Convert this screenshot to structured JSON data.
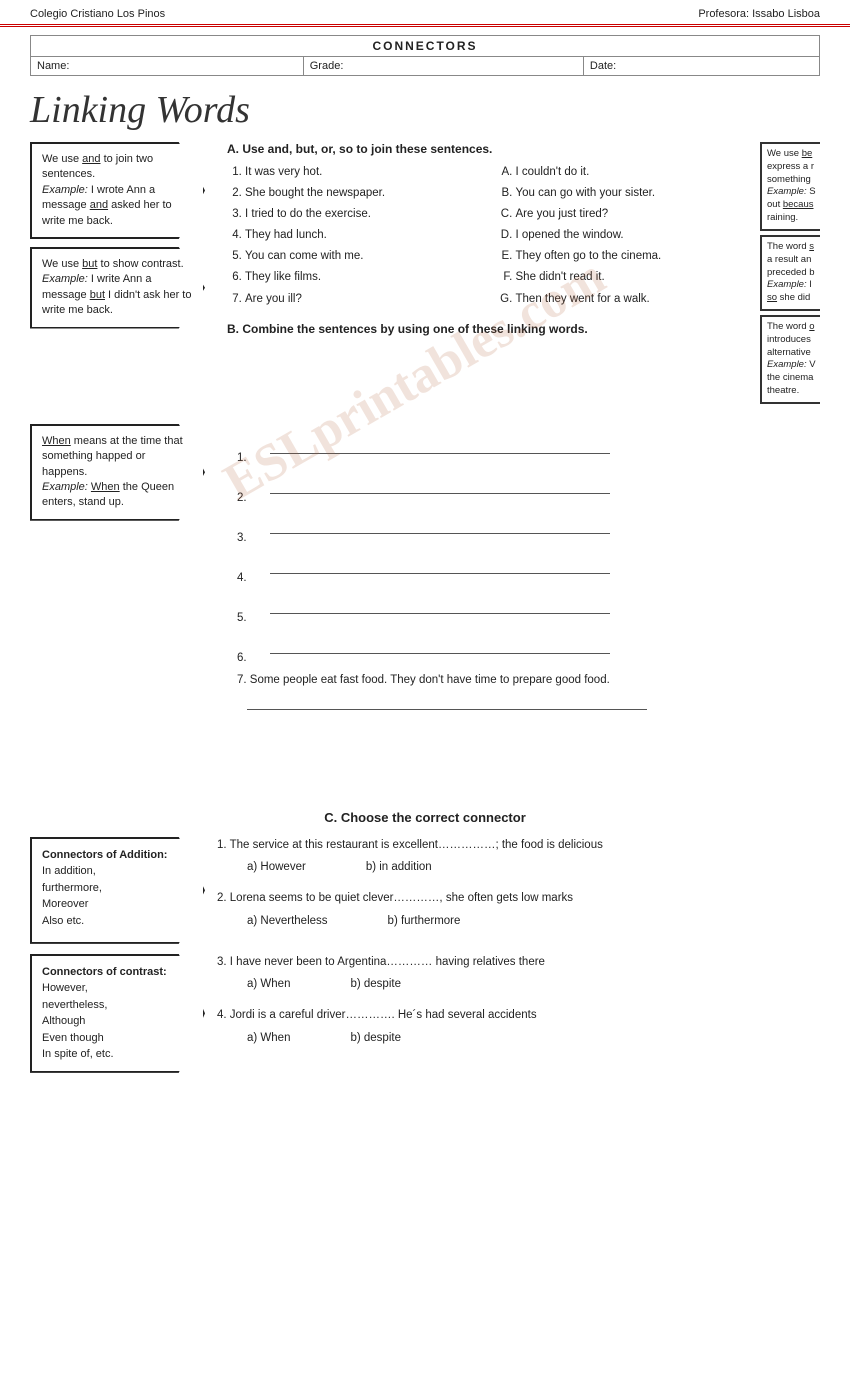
{
  "header": {
    "school": "Colegio Cristiano Los Pinos",
    "teacher": "Profesora: Issabo Lisboa"
  },
  "info_table": {
    "title": "CONNECTORS",
    "name_label": "Name:",
    "grade_label": "Grade:",
    "date_label": "Date:"
  },
  "page_title": "Linking Words",
  "panels": {
    "and_panel": {
      "main": "We use and to join two sentences.",
      "example_label": "Example:",
      "example_text": " I wrote Ann a message and asked her to write me back."
    },
    "but_panel": {
      "main": "We use but to show contrast.",
      "example_label": "Example:",
      "example_text": " I write Ann a message but I didn't ask her to write me back."
    },
    "when_panel": {
      "main": "When means at the time that something happed or happens.",
      "example_label": "Example:",
      "example_text": " When the Queen enters, stand up."
    }
  },
  "right_panels": {
    "because": {
      "intro": "We use be",
      "text": "express a reason for something.",
      "example_label": "Example: S",
      "example_text": "out becaus raining."
    },
    "so": {
      "intro": "The word s",
      "text": "a result an preceded b",
      "example_label": "Example: I",
      "example_text": "so she did"
    },
    "or": {
      "intro": "The word o",
      "text": "introduces alternative",
      "example_label": "Example: V",
      "example_text": "the cinema theatre."
    }
  },
  "exercise_a": {
    "title": "A. Use and, but, or, so to join these sentences.",
    "sentences_left": [
      "It was very hot.",
      "She bought the newspaper.",
      "I tried to do the exercise.",
      "They had lunch.",
      "You can come with me.",
      "They like films.",
      "Are you ill?"
    ],
    "sentences_right": [
      "I couldn't do it.",
      "You can go with your sister.",
      "Are you just tired?",
      "I opened the window.",
      "They often go to the cinema.",
      "She didn't read it.",
      "Then they went for a walk."
    ],
    "labels_right": [
      "A.",
      "B.",
      "C.",
      "D.",
      "E.",
      "F.",
      "G."
    ]
  },
  "exercise_b": {
    "title": "B. Combine the sentences by using one of these linking words.",
    "item7": "7.   Some people eat fast food. They don't have time to prepare good food."
  },
  "exercise_c": {
    "title": "C. Choose the correct connector",
    "questions": [
      {
        "num": "1.",
        "text": "The service at this restaurant is excellent……………; the food is delicious",
        "options": [
          "a)  However",
          "b) in addition"
        ]
      },
      {
        "num": "2.",
        "text": "Lorena seems to be quiet clever…………, she often gets low marks",
        "options": [
          "a)  Nevertheless",
          "b) furthermore"
        ]
      },
      {
        "num": "3.",
        "text": "I have never been to Argentina………… having relatives there",
        "options": [
          "a)  When",
          "b) despite"
        ]
      },
      {
        "num": "4.",
        "text": "Jordi is a careful driver…………. He´s had several accidents",
        "options": [
          "a)  When",
          "b) despite"
        ]
      }
    ],
    "addition_box": {
      "title": "Connectors of Addition:",
      "items": [
        "In addition,",
        "furthermore,",
        "",
        "Moreover",
        "",
        "Also etc."
      ]
    },
    "contrast_box": {
      "title": "Connectors of contrast:",
      "items": [
        "However,",
        "nevertheless,",
        "",
        "Although",
        "",
        "Even though",
        "",
        "In spite of, etc."
      ]
    }
  },
  "watermark": "ESLprintables.com"
}
